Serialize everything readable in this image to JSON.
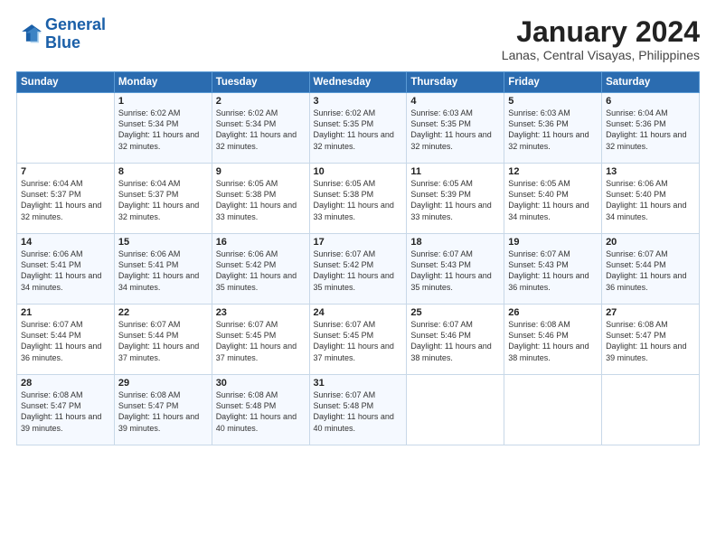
{
  "logo": {
    "line1": "General",
    "line2": "Blue"
  },
  "title": "January 2024",
  "location": "Lanas, Central Visayas, Philippines",
  "weekdays": [
    "Sunday",
    "Monday",
    "Tuesday",
    "Wednesday",
    "Thursday",
    "Friday",
    "Saturday"
  ],
  "weeks": [
    [
      {
        "day": "",
        "sunrise": "",
        "sunset": "",
        "daylight": ""
      },
      {
        "day": "1",
        "sunrise": "Sunrise: 6:02 AM",
        "sunset": "Sunset: 5:34 PM",
        "daylight": "Daylight: 11 hours and 32 minutes."
      },
      {
        "day": "2",
        "sunrise": "Sunrise: 6:02 AM",
        "sunset": "Sunset: 5:34 PM",
        "daylight": "Daylight: 11 hours and 32 minutes."
      },
      {
        "day": "3",
        "sunrise": "Sunrise: 6:02 AM",
        "sunset": "Sunset: 5:35 PM",
        "daylight": "Daylight: 11 hours and 32 minutes."
      },
      {
        "day": "4",
        "sunrise": "Sunrise: 6:03 AM",
        "sunset": "Sunset: 5:35 PM",
        "daylight": "Daylight: 11 hours and 32 minutes."
      },
      {
        "day": "5",
        "sunrise": "Sunrise: 6:03 AM",
        "sunset": "Sunset: 5:36 PM",
        "daylight": "Daylight: 11 hours and 32 minutes."
      },
      {
        "day": "6",
        "sunrise": "Sunrise: 6:04 AM",
        "sunset": "Sunset: 5:36 PM",
        "daylight": "Daylight: 11 hours and 32 minutes."
      }
    ],
    [
      {
        "day": "7",
        "sunrise": "Sunrise: 6:04 AM",
        "sunset": "Sunset: 5:37 PM",
        "daylight": "Daylight: 11 hours and 32 minutes."
      },
      {
        "day": "8",
        "sunrise": "Sunrise: 6:04 AM",
        "sunset": "Sunset: 5:37 PM",
        "daylight": "Daylight: 11 hours and 32 minutes."
      },
      {
        "day": "9",
        "sunrise": "Sunrise: 6:05 AM",
        "sunset": "Sunset: 5:38 PM",
        "daylight": "Daylight: 11 hours and 33 minutes."
      },
      {
        "day": "10",
        "sunrise": "Sunrise: 6:05 AM",
        "sunset": "Sunset: 5:38 PM",
        "daylight": "Daylight: 11 hours and 33 minutes."
      },
      {
        "day": "11",
        "sunrise": "Sunrise: 6:05 AM",
        "sunset": "Sunset: 5:39 PM",
        "daylight": "Daylight: 11 hours and 33 minutes."
      },
      {
        "day": "12",
        "sunrise": "Sunrise: 6:05 AM",
        "sunset": "Sunset: 5:40 PM",
        "daylight": "Daylight: 11 hours and 34 minutes."
      },
      {
        "day": "13",
        "sunrise": "Sunrise: 6:06 AM",
        "sunset": "Sunset: 5:40 PM",
        "daylight": "Daylight: 11 hours and 34 minutes."
      }
    ],
    [
      {
        "day": "14",
        "sunrise": "Sunrise: 6:06 AM",
        "sunset": "Sunset: 5:41 PM",
        "daylight": "Daylight: 11 hours and 34 minutes."
      },
      {
        "day": "15",
        "sunrise": "Sunrise: 6:06 AM",
        "sunset": "Sunset: 5:41 PM",
        "daylight": "Daylight: 11 hours and 34 minutes."
      },
      {
        "day": "16",
        "sunrise": "Sunrise: 6:06 AM",
        "sunset": "Sunset: 5:42 PM",
        "daylight": "Daylight: 11 hours and 35 minutes."
      },
      {
        "day": "17",
        "sunrise": "Sunrise: 6:07 AM",
        "sunset": "Sunset: 5:42 PM",
        "daylight": "Daylight: 11 hours and 35 minutes."
      },
      {
        "day": "18",
        "sunrise": "Sunrise: 6:07 AM",
        "sunset": "Sunset: 5:43 PM",
        "daylight": "Daylight: 11 hours and 35 minutes."
      },
      {
        "day": "19",
        "sunrise": "Sunrise: 6:07 AM",
        "sunset": "Sunset: 5:43 PM",
        "daylight": "Daylight: 11 hours and 36 minutes."
      },
      {
        "day": "20",
        "sunrise": "Sunrise: 6:07 AM",
        "sunset": "Sunset: 5:44 PM",
        "daylight": "Daylight: 11 hours and 36 minutes."
      }
    ],
    [
      {
        "day": "21",
        "sunrise": "Sunrise: 6:07 AM",
        "sunset": "Sunset: 5:44 PM",
        "daylight": "Daylight: 11 hours and 36 minutes."
      },
      {
        "day": "22",
        "sunrise": "Sunrise: 6:07 AM",
        "sunset": "Sunset: 5:44 PM",
        "daylight": "Daylight: 11 hours and 37 minutes."
      },
      {
        "day": "23",
        "sunrise": "Sunrise: 6:07 AM",
        "sunset": "Sunset: 5:45 PM",
        "daylight": "Daylight: 11 hours and 37 minutes."
      },
      {
        "day": "24",
        "sunrise": "Sunrise: 6:07 AM",
        "sunset": "Sunset: 5:45 PM",
        "daylight": "Daylight: 11 hours and 37 minutes."
      },
      {
        "day": "25",
        "sunrise": "Sunrise: 6:07 AM",
        "sunset": "Sunset: 5:46 PM",
        "daylight": "Daylight: 11 hours and 38 minutes."
      },
      {
        "day": "26",
        "sunrise": "Sunrise: 6:08 AM",
        "sunset": "Sunset: 5:46 PM",
        "daylight": "Daylight: 11 hours and 38 minutes."
      },
      {
        "day": "27",
        "sunrise": "Sunrise: 6:08 AM",
        "sunset": "Sunset: 5:47 PM",
        "daylight": "Daylight: 11 hours and 39 minutes."
      }
    ],
    [
      {
        "day": "28",
        "sunrise": "Sunrise: 6:08 AM",
        "sunset": "Sunset: 5:47 PM",
        "daylight": "Daylight: 11 hours and 39 minutes."
      },
      {
        "day": "29",
        "sunrise": "Sunrise: 6:08 AM",
        "sunset": "Sunset: 5:47 PM",
        "daylight": "Daylight: 11 hours and 39 minutes."
      },
      {
        "day": "30",
        "sunrise": "Sunrise: 6:08 AM",
        "sunset": "Sunset: 5:48 PM",
        "daylight": "Daylight: 11 hours and 40 minutes."
      },
      {
        "day": "31",
        "sunrise": "Sunrise: 6:07 AM",
        "sunset": "Sunset: 5:48 PM",
        "daylight": "Daylight: 11 hours and 40 minutes."
      },
      {
        "day": "",
        "sunrise": "",
        "sunset": "",
        "daylight": ""
      },
      {
        "day": "",
        "sunrise": "",
        "sunset": "",
        "daylight": ""
      },
      {
        "day": "",
        "sunrise": "",
        "sunset": "",
        "daylight": ""
      }
    ]
  ]
}
